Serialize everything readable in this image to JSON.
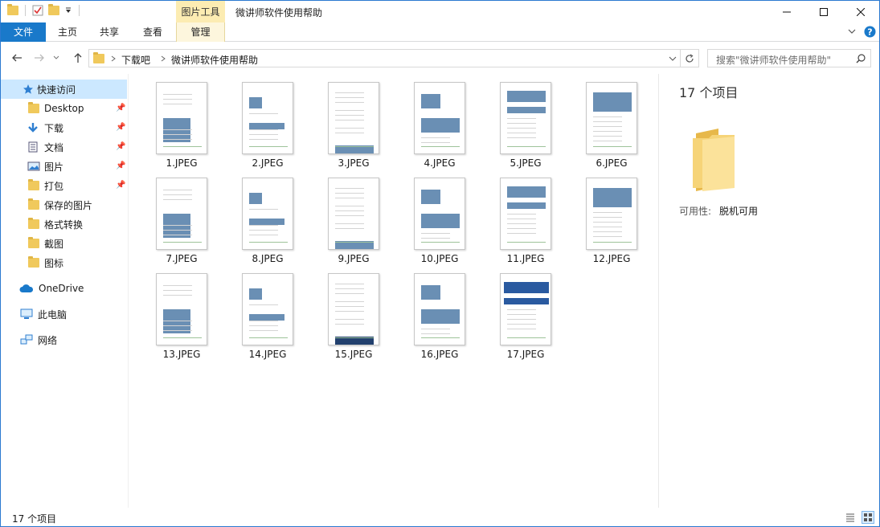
{
  "window": {
    "title": "微讲师软件使用帮助",
    "context_tab": "图片工具",
    "controls": [
      "minimize",
      "maximize",
      "close"
    ]
  },
  "ribbon": {
    "tabs": [
      {
        "label": "文件"
      },
      {
        "label": "主页"
      },
      {
        "label": "共享"
      },
      {
        "label": "查看"
      },
      {
        "label": "管理"
      }
    ]
  },
  "address": {
    "crumbs": [
      "下载吧",
      "微讲师软件使用帮助"
    ],
    "search_placeholder": "搜索\"微讲师软件使用帮助\""
  },
  "nav": {
    "quick_access": "快速访问",
    "items": [
      {
        "label": "Desktop",
        "icon": "folder-icon",
        "pinned": true
      },
      {
        "label": "下载",
        "icon": "download-arrow-icon",
        "pinned": true
      },
      {
        "label": "文档",
        "icon": "document-icon",
        "pinned": true
      },
      {
        "label": "图片",
        "icon": "pictures-icon",
        "pinned": true
      },
      {
        "label": "打包",
        "icon": "folder-icon",
        "pinned": true
      },
      {
        "label": "保存的图片",
        "icon": "folder-icon",
        "pinned": false
      },
      {
        "label": "格式转换",
        "icon": "folder-icon",
        "pinned": false
      },
      {
        "label": "截图",
        "icon": "folder-icon",
        "pinned": false
      },
      {
        "label": "图标",
        "icon": "folder-icon",
        "pinned": false
      }
    ],
    "onedrive": "OneDrive",
    "this_pc": "此电脑",
    "network": "网络"
  },
  "files": [
    {
      "name": "1.JPEG"
    },
    {
      "name": "2.JPEG"
    },
    {
      "name": "3.JPEG"
    },
    {
      "name": "4.JPEG"
    },
    {
      "name": "5.JPEG"
    },
    {
      "name": "6.JPEG"
    },
    {
      "name": "7.JPEG"
    },
    {
      "name": "8.JPEG"
    },
    {
      "name": "9.JPEG"
    },
    {
      "name": "10.JPEG"
    },
    {
      "name": "11.JPEG"
    },
    {
      "name": "12.JPEG"
    },
    {
      "name": "13.JPEG"
    },
    {
      "name": "14.JPEG"
    },
    {
      "name": "15.JPEG"
    },
    {
      "name": "16.JPEG"
    },
    {
      "name": "17.JPEG"
    }
  ],
  "details": {
    "count": "17 个项目",
    "availability_label": "可用性:",
    "availability_value": "脱机可用"
  },
  "status": {
    "text": "17 个项目"
  },
  "colors": {
    "file_tab": "#1979ca",
    "selected": "#cce8ff",
    "context_tab": "#fcecb2",
    "folder": "#f0c95c"
  }
}
